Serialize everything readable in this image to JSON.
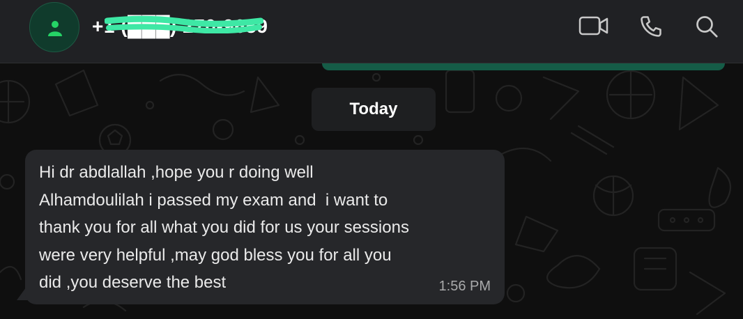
{
  "header": {
    "contact_name": "+1 (███) 270-9659",
    "icons": [
      "video-call-icon",
      "voice-call-icon",
      "search-icon"
    ]
  },
  "chat": {
    "date_divider": "Today",
    "messages": [
      {
        "direction": "incoming",
        "lines": [
          "Hi dr abdlallah ,hope you r doing well",
          "Alhamdoulilah i passed my exam and  i want to",
          "thank you for all what you did for us your sessions",
          "were very helpful ,may god bless you for all you",
          "did ,you deserve the best"
        ],
        "time": "1:56 PM"
      }
    ]
  },
  "colors": {
    "header_bg": "#202124",
    "chat_bg": "#0f0f0f",
    "incoming_bubble": "#26272a",
    "outgoing_bubble": "#155c47",
    "accent_green": "#25d366"
  }
}
